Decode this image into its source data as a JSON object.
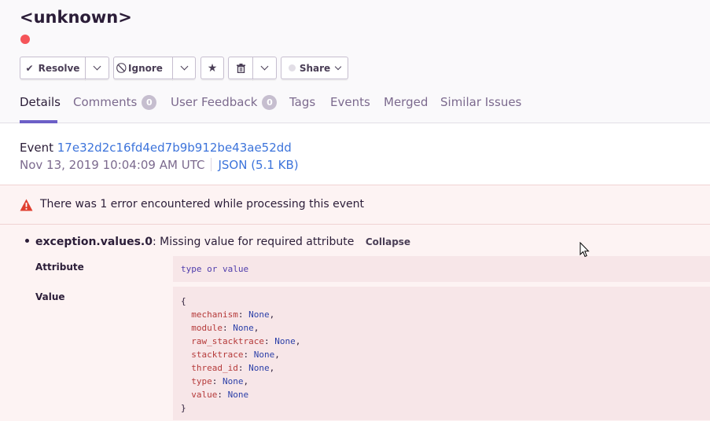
{
  "issue": {
    "title": "<unknown>",
    "level_color": "#f55459"
  },
  "toolbar": {
    "resolve_label": "Resolve",
    "ignore_label": "Ignore",
    "share_label": "Share",
    "icons": [
      "checkmark-icon",
      "chevron-down-icon",
      "ignore-icon",
      "star-icon",
      "trash-icon",
      "share-dot-icon"
    ]
  },
  "tabs": [
    {
      "label": "Details",
      "active": true
    },
    {
      "label": "Comments",
      "badge": "0"
    },
    {
      "label": "User Feedback",
      "badge": "0"
    },
    {
      "label": "Tags"
    },
    {
      "label": "Events"
    },
    {
      "label": "Merged"
    },
    {
      "label": "Similar Issues"
    }
  ],
  "event": {
    "prefix": "Event",
    "id": "17e32d2c16fd4ed7b9b912be43ae52dd",
    "timestamp": "Nov 13, 2019 10:04:09 AM UTC",
    "json_link": "JSON (5.1 KB)"
  },
  "error_panel": {
    "message": "There was 1 error encountered while processing this event",
    "item": {
      "key": "exception.values.0",
      "description": ": Missing value for required attribute",
      "collapse_label": "Collapse",
      "attribute_label": "Attribute",
      "attribute_value": "type or value",
      "value_label": "Value",
      "value_lines": [
        {
          "text": "{"
        },
        {
          "key": "mechanism",
          "val": "None",
          "end": ","
        },
        {
          "key": "module",
          "val": "None",
          "end": ","
        },
        {
          "key": "raw_stacktrace",
          "val": "None",
          "end": ","
        },
        {
          "key": "stacktrace",
          "val": "None",
          "end": ","
        },
        {
          "key": "thread_id",
          "val": "None",
          "end": ","
        },
        {
          "key": "type",
          "val": "None",
          "end": ","
        },
        {
          "key": "value",
          "val": "None",
          "end": ""
        },
        {
          "text": "}"
        }
      ]
    }
  },
  "colors": {
    "accent": "#6c5fc7",
    "link": "#3d74db",
    "error_bg": "#fdf3f3",
    "warning_red": "#e03e2f"
  }
}
